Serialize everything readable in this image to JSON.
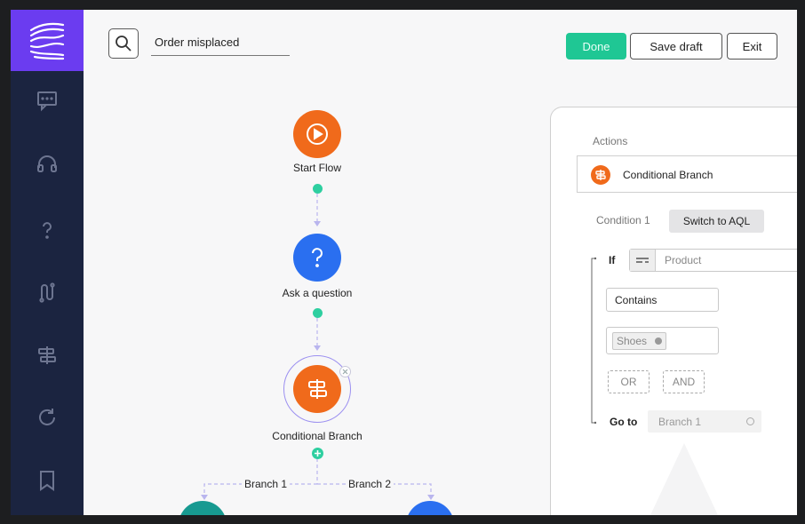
{
  "header": {
    "flow_name": "Order misplaced",
    "done_label": "Done",
    "save_draft_label": "Save draft",
    "exit_label": "Exit"
  },
  "sidebar": {
    "items": [
      {
        "icon": "chat-icon"
      },
      {
        "icon": "headset-icon"
      },
      {
        "icon": "question-icon"
      },
      {
        "icon": "route-icon"
      },
      {
        "icon": "branch-icon"
      },
      {
        "icon": "refresh-icon"
      },
      {
        "icon": "bookmark-icon"
      }
    ]
  },
  "canvas": {
    "nodes": [
      {
        "label": "Start Flow",
        "icon": "play-icon",
        "color": "#f06a1b"
      },
      {
        "label": "Ask a question",
        "icon": "question-icon",
        "color": "#2a6ff0"
      },
      {
        "label": "Conditional Branch",
        "icon": "branch-icon",
        "color": "#f06a1b"
      }
    ],
    "branches": [
      "Branch 1",
      "Branch 2"
    ],
    "child_colors": [
      "#179a91",
      "#2a6ff0"
    ]
  },
  "panel": {
    "actions_label": "Actions",
    "title": "Conditional Branch",
    "tab_condition": "Condition 1",
    "switch_aql": "Switch to AQL",
    "if_label": "If",
    "field_placeholder": "Product",
    "operator": "Contains",
    "tag": "Shoes",
    "or_label": "OR",
    "and_label": "AND",
    "goto_label": "Go to",
    "goto_value": "Branch 1"
  },
  "colors": {
    "accent": "#1fc794",
    "sidebar": "#1b2440",
    "logo_bg": "#6b3cf0",
    "orange": "#f06a1b",
    "blue": "#2a6ff0",
    "connector": "#2ecfa0"
  }
}
